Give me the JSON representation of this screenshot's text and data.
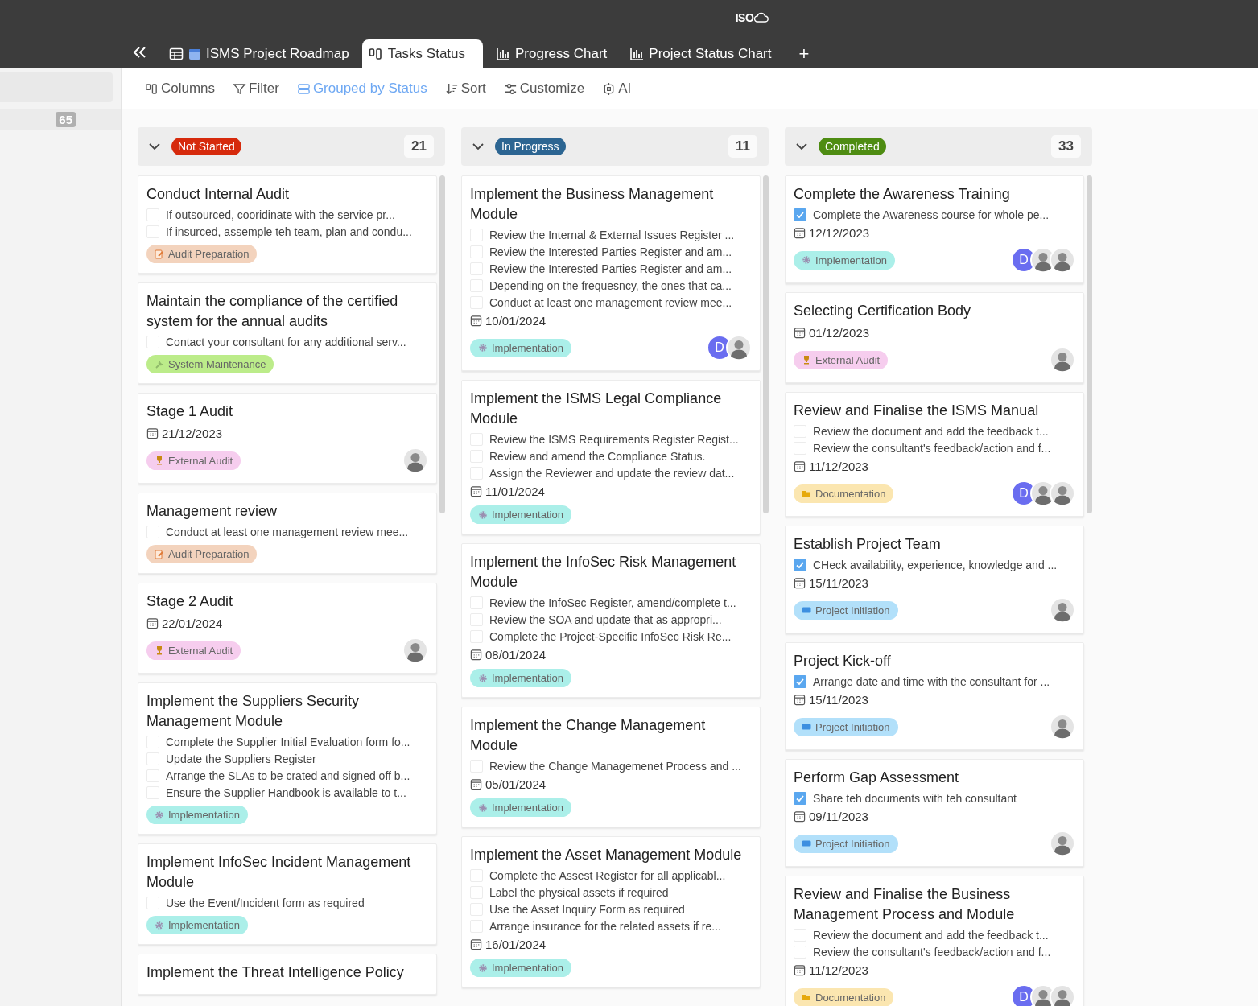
{
  "top_bar": {
    "logo": "ISO"
  },
  "tabs": [
    {
      "label": "ISMS Project Roadmap",
      "kind": "table",
      "selected": false
    },
    {
      "label": "Tasks Status",
      "kind": "board",
      "selected": true
    },
    {
      "label": "Progress Chart",
      "kind": "chart",
      "selected": false
    },
    {
      "label": "Project Status Chart",
      "kind": "chart",
      "selected": false
    }
  ],
  "add_tab": "+",
  "sidebar": {
    "count": "65"
  },
  "toolbar": [
    {
      "label": "Columns",
      "kind": "columns",
      "selected": false
    },
    {
      "label": "Filter",
      "kind": "filter",
      "selected": false
    },
    {
      "label": "Grouped by Status",
      "kind": "group",
      "selected": true
    },
    {
      "label": "Sort",
      "kind": "sort",
      "selected": false
    },
    {
      "label": "Customize",
      "kind": "customize",
      "selected": false
    },
    {
      "label": "AI",
      "kind": "ai",
      "selected": false
    }
  ],
  "groups": [
    {
      "status": "Not Started",
      "color": "#d62a0c",
      "count": "21",
      "expanded": true,
      "cards": [
        {
          "title": "Conduct Internal Audit",
          "subtasks": [
            {
              "text": "If outsourced, cooridinate with the service pr...",
              "checked": false
            },
            {
              "text": "If insurced, assemple teh team, plan and condu...",
              "checked": false
            }
          ],
          "tag": {
            "kind": "audit",
            "label": "Audit Preparation",
            "color": "#f3d3bd"
          }
        },
        {
          "title": "Maintain the compliance of the certified system for the annual audits",
          "subtasks": [
            {
              "text": "Contact your consultant for any additional serv...",
              "checked": false
            }
          ],
          "tag": {
            "kind": "maintenance",
            "label": "System Maintenance",
            "color": "#bcec8a"
          }
        },
        {
          "title": "Stage 1 Audit",
          "date": "21/12/2023",
          "tag": {
            "kind": "external",
            "label": "External Audit",
            "color": "#f6cdee"
          },
          "avatars": [
            {
              "kind": "photo"
            }
          ]
        },
        {
          "title": "Management review",
          "subtasks": [
            {
              "text": "Conduct at least one management review mee...",
              "checked": false
            }
          ],
          "tag": {
            "kind": "audit",
            "label": "Audit Preparation",
            "color": "#f3d3bd"
          }
        },
        {
          "title": "Stage 2 Audit",
          "date": "22/01/2024",
          "tag": {
            "kind": "external",
            "label": "External Audit",
            "color": "#f6cdee"
          },
          "avatars": [
            {
              "kind": "photo"
            }
          ]
        },
        {
          "title": "Implement the Suppliers Security Management Module",
          "subtasks": [
            {
              "text": "Complete the Supplier Initial Evaluation form fo...",
              "checked": false
            },
            {
              "text": "Update the Suppliers Register",
              "checked": false
            },
            {
              "text": "Arrange the SLAs to be crated and signed off b...",
              "checked": false
            },
            {
              "text": "Ensure the Supplier Handbook is available to t...",
              "checked": false
            }
          ],
          "tag": {
            "kind": "implementation",
            "label": "Implementation",
            "color": "#abefe9"
          }
        },
        {
          "title": "Implement InfoSec Incident Management Module",
          "subtasks": [
            {
              "text": "Use the Event/Incident form as required",
              "checked": false
            }
          ],
          "tag": {
            "kind": "implementation",
            "label": "Implementation",
            "color": "#abefe9"
          }
        },
        {
          "title": "Implement the Threat Intelligence Policy"
        }
      ]
    },
    {
      "status": "In Progress",
      "color": "#2c6592",
      "count": "11",
      "expanded": true,
      "cards": [
        {
          "title": "Implement the Business Management Module",
          "subtasks": [
            {
              "text": "Review the Internal & External Issues Register ...",
              "checked": false
            },
            {
              "text": "Review the Interested Parties Register and am...",
              "checked": false
            },
            {
              "text": "Review the Interested Parties Register and am...",
              "checked": false
            },
            {
              "text": "Depending on the frequesncy, the ones that ca...",
              "checked": false
            },
            {
              "text": "Conduct at least one management review mee...",
              "checked": false
            }
          ],
          "date": "10/01/2024",
          "tag": {
            "kind": "implementation",
            "label": "Implementation",
            "color": "#abefe9"
          },
          "avatars": [
            {
              "kind": "initials",
              "text": "D"
            },
            {
              "kind": "photo"
            }
          ]
        },
        {
          "title": "Implement the ISMS Legal Compliance Module",
          "subtasks": [
            {
              "text": "Review the ISMS Requirements Register Regist...",
              "checked": false
            },
            {
              "text": "Review and amend the Compliance Status.",
              "checked": false
            },
            {
              "text": "Assign the Reviewer and update the review dat...",
              "checked": false
            }
          ],
          "date": "11/01/2024",
          "tag": {
            "kind": "implementation",
            "label": "Implementation",
            "color": "#abefe9"
          }
        },
        {
          "title": "Implement the InfoSec Risk Management Module",
          "subtasks": [
            {
              "text": "Review the InfoSec Register, amend/complete t...",
              "checked": false
            },
            {
              "text": "Review the SOA and update that as appropri...",
              "checked": false
            },
            {
              "text": "Complete the Project-Specific InfoSec Risk Re...",
              "checked": false
            }
          ],
          "date": "08/01/2024",
          "tag": {
            "kind": "implementation",
            "label": "Implementation",
            "color": "#abefe9"
          }
        },
        {
          "title": "Implement the Change Management Module",
          "subtasks": [
            {
              "text": "Review the Change Managemenet Process and ...",
              "checked": false
            }
          ],
          "date": "05/01/2024",
          "tag": {
            "kind": "implementation",
            "label": "Implementation",
            "color": "#abefe9"
          }
        },
        {
          "title": "Implement the Asset Management Module",
          "subtasks": [
            {
              "text": "Complete the Assest Register for all applicabl...",
              "checked": false
            },
            {
              "text": "Label the physical assets if required",
              "checked": false
            },
            {
              "text": "Use the Asset Inquiry Form as required",
              "checked": false
            },
            {
              "text": "Arrange insurance for the related assets if re...",
              "checked": false
            }
          ],
          "date": "16/01/2024",
          "tag": {
            "kind": "implementation",
            "label": "Implementation",
            "color": "#abefe9"
          }
        }
      ]
    },
    {
      "status": "Completed",
      "color": "#4e8c12",
      "count": "33",
      "expanded": true,
      "cards": [
        {
          "title": "Complete the Awareness Training",
          "subtasks": [
            {
              "text": "Complete the Awareness course for whole pe...",
              "checked": true
            }
          ],
          "date": "12/12/2023",
          "tag": {
            "kind": "implementation",
            "label": "Implementation",
            "color": "#abefe9"
          },
          "avatars": [
            {
              "kind": "initials",
              "text": "D"
            },
            {
              "kind": "photo"
            },
            {
              "kind": "photo"
            }
          ]
        },
        {
          "title": "Selecting Certification Body",
          "date": "01/12/2023",
          "tag": {
            "kind": "external",
            "label": "External Audit",
            "color": "#f6cdee"
          },
          "avatars": [
            {
              "kind": "photo"
            }
          ]
        },
        {
          "title": "Review and Finalise the ISMS Manual",
          "subtasks": [
            {
              "text": "Review the document and add the feedback t...",
              "checked": false
            },
            {
              "text": "Review the consultant's feedback/action and f...",
              "checked": false
            }
          ],
          "date": "11/12/2023",
          "tag": {
            "kind": "documentation",
            "label": "Documentation",
            "color": "#fbe6b0"
          },
          "avatars": [
            {
              "kind": "initials",
              "text": "D"
            },
            {
              "kind": "photo"
            },
            {
              "kind": "photo"
            }
          ]
        },
        {
          "title": "Establish Project Team",
          "subtasks": [
            {
              "text": "CHeck availability, experience, knowledge and ...",
              "checked": true
            }
          ],
          "date": "15/11/2023",
          "tag": {
            "kind": "initiation",
            "label": "Project Initiation",
            "color": "#b2e0fa"
          },
          "avatars": [
            {
              "kind": "photo"
            }
          ]
        },
        {
          "title": "Project Kick-off",
          "subtasks": [
            {
              "text": "Arrange date and time with the consultant for ...",
              "checked": true
            }
          ],
          "date": "15/11/2023",
          "tag": {
            "kind": "initiation",
            "label": "Project Initiation",
            "color": "#b2e0fa"
          },
          "avatars": [
            {
              "kind": "photo"
            }
          ]
        },
        {
          "title": "Perform Gap Assessment",
          "subtasks": [
            {
              "text": "Share teh documents with teh consultant",
              "checked": true
            }
          ],
          "date": "09/11/2023",
          "tag": {
            "kind": "initiation",
            "label": "Project Initiation",
            "color": "#b2e0fa"
          },
          "avatars": [
            {
              "kind": "photo"
            }
          ]
        },
        {
          "title": "Review and Finalise the Business Management Process and Module",
          "subtasks": [
            {
              "text": "Review the document and add the feedback t...",
              "checked": false
            },
            {
              "text": "Review the consultant's feedback/action and f...",
              "checked": false
            }
          ],
          "date": "11/12/2023",
          "tag": {
            "kind": "documentation",
            "label": "Documentation",
            "color": "#fbe6b0"
          },
          "avatars": [
            {
              "kind": "initials",
              "text": "D"
            },
            {
              "kind": "photo"
            },
            {
              "kind": "photo"
            }
          ]
        }
      ]
    }
  ]
}
